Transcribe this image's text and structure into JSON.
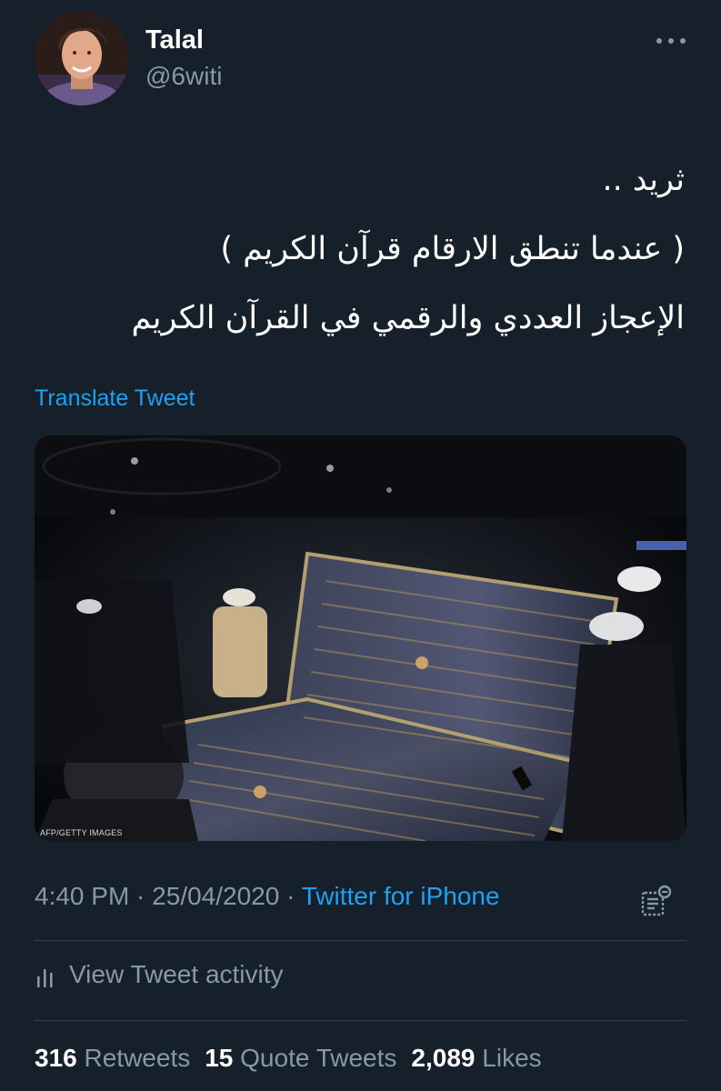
{
  "author": {
    "name": "Talal",
    "handle": "@6witi"
  },
  "tweet": {
    "lines": [
      "ثريد ..",
      "( عندما تنطق الارقام قرآن الكريم )",
      "الإعجاز العددي والرقمي في القرآن الكريم"
    ],
    "translate_label": "Translate Tweet",
    "media_credit": "AFP/GETTY IMAGES",
    "time": "4:40 PM",
    "separator": " · ",
    "date": "25/04/2020",
    "source": "Twitter for iPhone"
  },
  "activity": {
    "label": "View Tweet activity"
  },
  "stats": {
    "retweets_count": "316",
    "retweets_label": "Retweets",
    "quotes_count": "15",
    "quotes_label": "Quote Tweets",
    "likes_count": "2,089",
    "likes_label": "Likes"
  },
  "icons": {
    "more": "more-icon",
    "analytics": "analytics-icon",
    "activity": "bar-chart-icon"
  },
  "colors": {
    "background": "#15202b",
    "accent": "#1da1f2",
    "secondary_text": "#8899a6",
    "divider": "#38444d"
  }
}
